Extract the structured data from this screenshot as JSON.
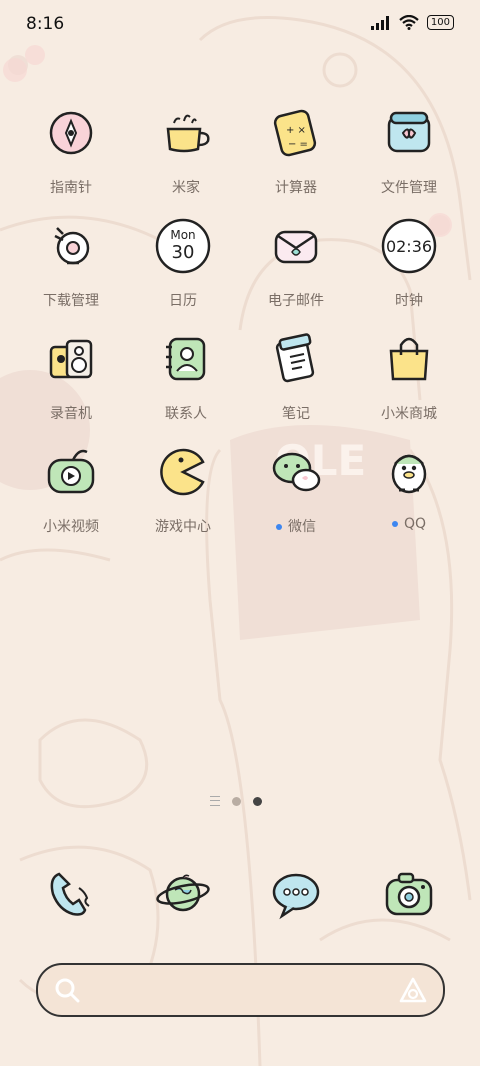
{
  "status": {
    "time": "8:16",
    "battery": "100"
  },
  "apps": [
    {
      "label": "指南针",
      "icon": "compass-icon"
    },
    {
      "label": "米家",
      "icon": "mihome-icon"
    },
    {
      "label": "计算器",
      "icon": "calculator-icon"
    },
    {
      "label": "文件管理",
      "icon": "file-manager-icon"
    },
    {
      "label": "下载管理",
      "icon": "download-manager-icon"
    },
    {
      "label": "日历",
      "icon": "calendar-icon",
      "icon_text_top": "Mon",
      "icon_text_bottom": "30"
    },
    {
      "label": "电子邮件",
      "icon": "email-icon"
    },
    {
      "label": "时钟",
      "icon": "clock-icon",
      "icon_text": "02:36"
    },
    {
      "label": "录音机",
      "icon": "recorder-icon"
    },
    {
      "label": "联系人",
      "icon": "contacts-icon"
    },
    {
      "label": "笔记",
      "icon": "notes-icon"
    },
    {
      "label": "小米商城",
      "icon": "mi-store-icon"
    },
    {
      "label": "小米视频",
      "icon": "mi-video-icon"
    },
    {
      "label": "游戏中心",
      "icon": "game-center-icon"
    },
    {
      "label": "微信",
      "icon": "wechat-icon",
      "new_dot": true
    },
    {
      "label": "QQ",
      "icon": "qq-icon",
      "new_dot": true
    }
  ],
  "pager": {
    "pages": 2,
    "active": 2
  },
  "dock": [
    {
      "icon": "phone-icon"
    },
    {
      "icon": "browser-globe-icon"
    },
    {
      "icon": "messages-icon"
    },
    {
      "icon": "camera-icon"
    }
  ],
  "search": {
    "left_icon": "search-icon",
    "right_icon": "assistant-icon"
  },
  "colors": {
    "background": "#f7ece2",
    "accent_dot": "#3d86f0"
  }
}
